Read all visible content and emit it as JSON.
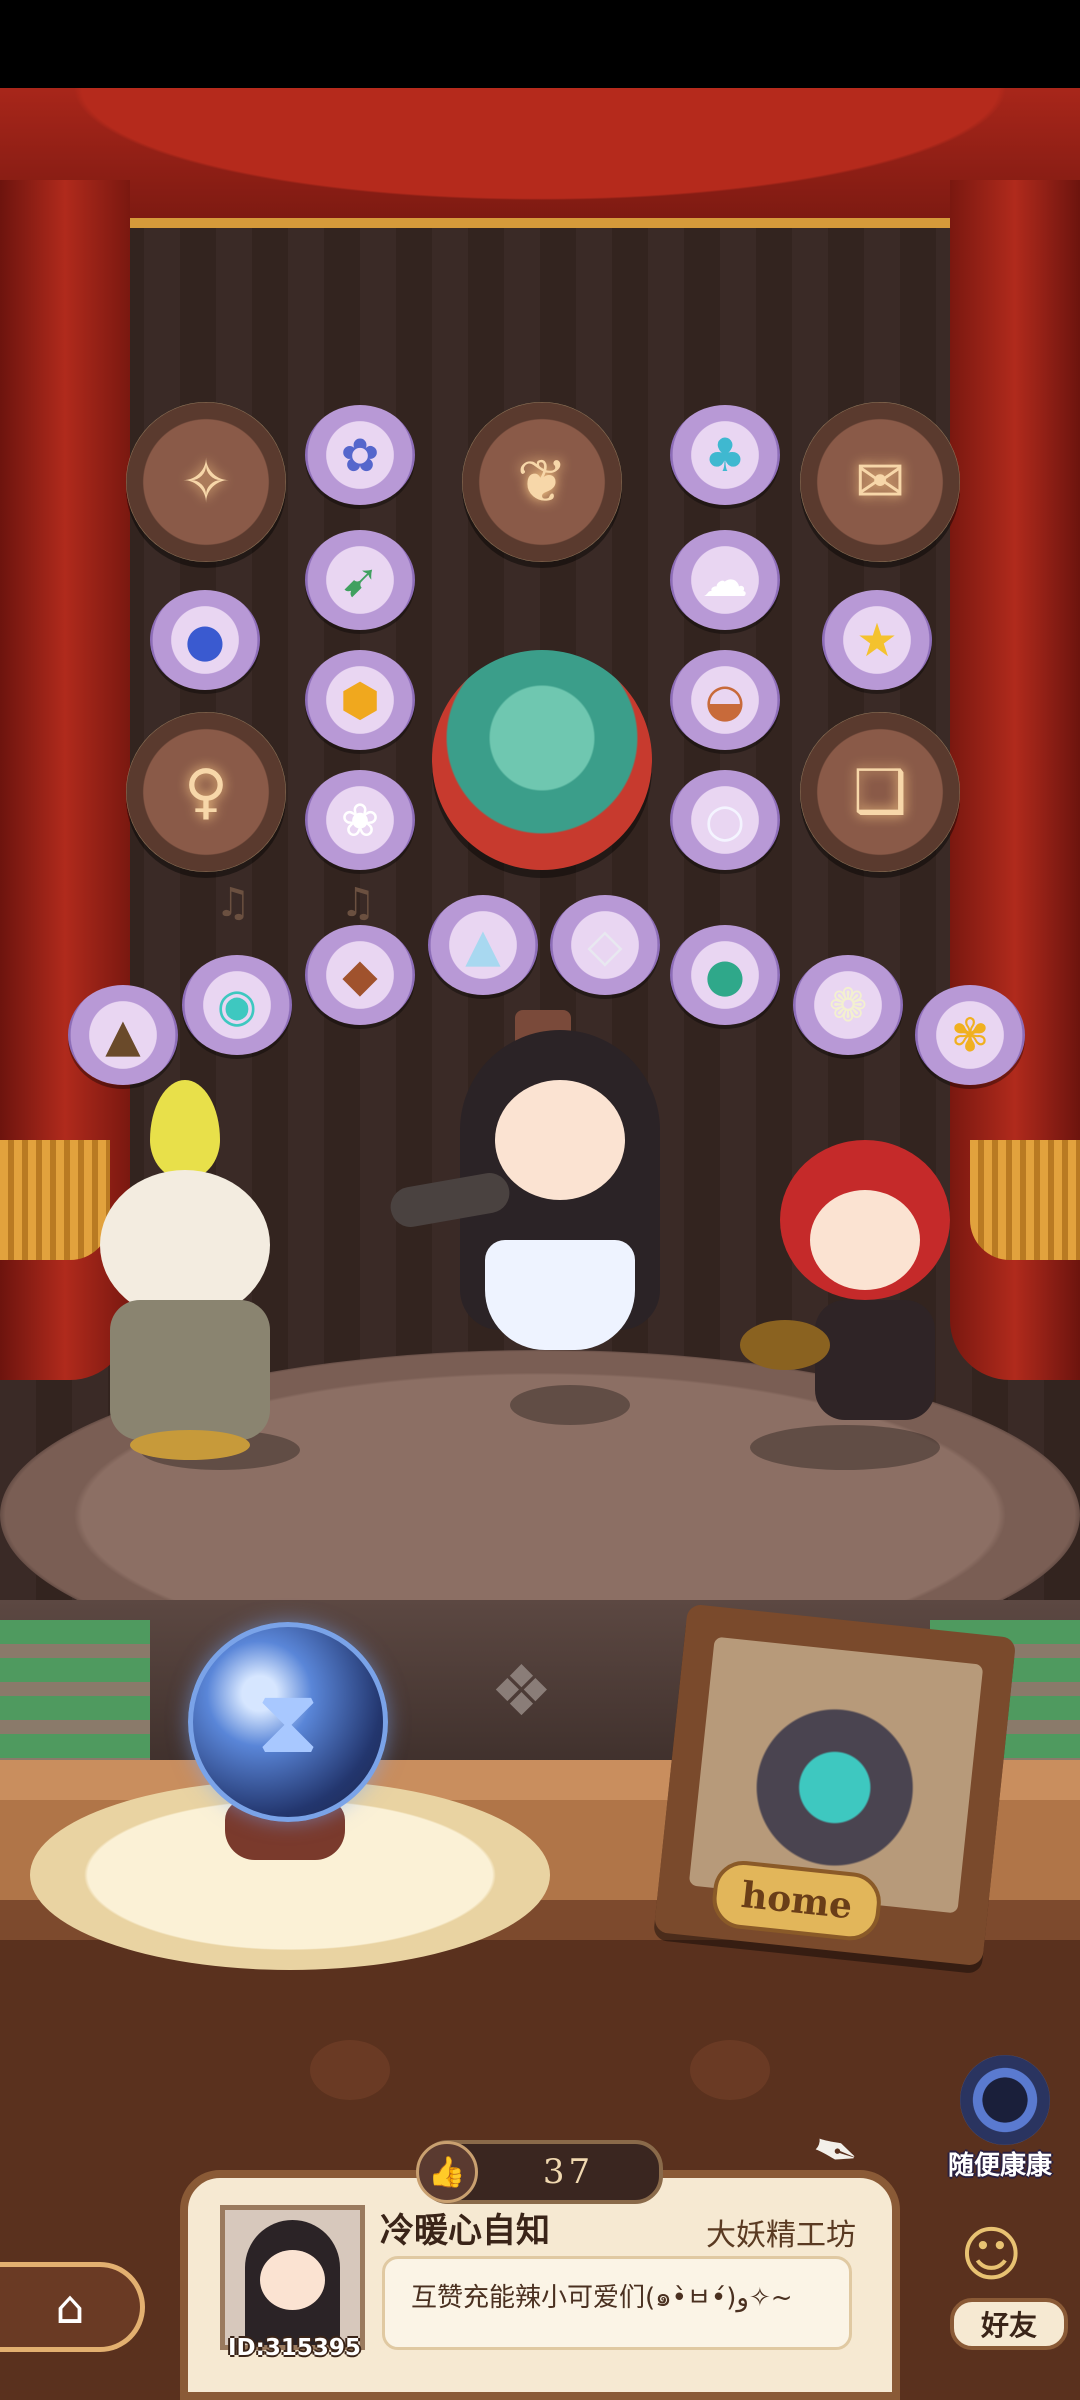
{
  "icons": {
    "badges": [
      "mask-badge",
      "flower-mask-badge",
      "certificate-badge",
      "fairy-badge",
      "book-badge"
    ],
    "items": [
      "blue-flower",
      "mushrooms",
      "blue-mushroom",
      "rainbow-feather",
      "cloud",
      "star",
      "honeycomb",
      "shell",
      "daisy",
      "pearl",
      "ore-pile",
      "water-plate",
      "amber-stick",
      "salt-crystal",
      "silver-ore",
      "pear",
      "lily",
      "gold-leaf"
    ],
    "center": "watermelon-painting"
  },
  "scene": {
    "home_sign": "home",
    "hourglass": "hourglass-icon"
  },
  "random_visit": {
    "label": "随便康康"
  },
  "profile": {
    "likes": "37",
    "nickname": "冷暖心自知",
    "shop_name": "大妖精工坊",
    "signature": "互赞充能辣小可爱们(๑•̀ㅂ•́)و✧~",
    "user_id": "ID:315395"
  },
  "nav": {
    "home_icon": "home-icon",
    "friends_label": "好友"
  },
  "colors": {
    "curtain": "#b02a1c",
    "wood": "#b07548",
    "card": "#f6e9d2",
    "accent_gold": "#e2b65a"
  }
}
